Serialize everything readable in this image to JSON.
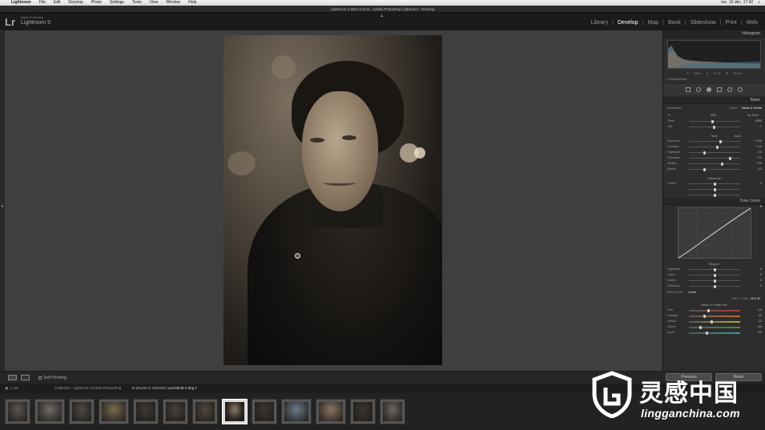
{
  "menubar": {
    "items": [
      "Lightroom",
      "File",
      "Edit",
      "Develop",
      "Photo",
      "Settings",
      "Tools",
      "View",
      "Window",
      "Help"
    ],
    "clock": "lun. 16 déc.  17:42"
  },
  "window": {
    "title": "Lightroom 4 2013-2.lrcat - Adobe Photoshop Lightroom - Develop"
  },
  "branding": {
    "lr": "Lr",
    "small": "Adobe Photoshop",
    "name": "Lightroom 5"
  },
  "modules": [
    {
      "label": "Library",
      "active": false
    },
    {
      "label": "Develop",
      "active": true
    },
    {
      "label": "Map",
      "active": false
    },
    {
      "label": "Book",
      "active": false
    },
    {
      "label": "Slideshow",
      "active": false
    },
    {
      "label": "Print",
      "active": false
    },
    {
      "label": "Web",
      "active": false
    }
  ],
  "right_panel": {
    "histogram_title": "Histogram",
    "hist_info": [
      "R",
      "0,5 %",
      "G",
      "0,7 %",
      "B",
      "10,0 %"
    ],
    "original_photo": "Original Photo",
    "basic_title": "Basic",
    "treatment_label": "Treatment :",
    "treatment_color": "Color",
    "treatment_bw": "Black & White",
    "wb_label": "WB :",
    "wb_value": "As Shot",
    "temp": {
      "label": "Temp",
      "value": "4500"
    },
    "tint": {
      "label": "Tint",
      "value": "- 7"
    },
    "tone_label": "Tone",
    "tone_auto": "Auto",
    "tone_sliders": [
      {
        "label": "Exposure",
        "value": "+ 1,00",
        "pos": 0.62
      },
      {
        "label": "Contrast",
        "value": "+ 13",
        "pos": 0.55
      },
      {
        "label": "Highlights",
        "value": "- 43",
        "pos": 0.3
      },
      {
        "label": "Shadows",
        "value": "+ 73",
        "pos": 0.8
      },
      {
        "label": "Whites",
        "value": "+ 30",
        "pos": 0.65
      },
      {
        "label": "Blacks",
        "value": "- 41",
        "pos": 0.3
      }
    ],
    "presence_label": "Presence",
    "presence_sliders": [
      {
        "label": "Clarity",
        "value": "0",
        "pos": 0.5
      },
      {
        "label": "",
        "value": "",
        "pos": 0.5
      },
      {
        "label": "",
        "value": "",
        "pos": 0.5
      }
    ],
    "tone_curve_title": "Tone Curve",
    "region_label": "Region",
    "region_sliders": [
      {
        "label": "Highlights",
        "value": "0",
        "pos": 0.5
      },
      {
        "label": "Lights",
        "value": "0",
        "pos": 0.5
      },
      {
        "label": "Darks",
        "value": "0",
        "pos": 0.5
      },
      {
        "label": "Shadows",
        "value": "0",
        "pos": 0.5
      }
    ],
    "point_curve_label": "Point Curve :",
    "point_curve_value": "Linear",
    "bw_tabs": [
      "HSL",
      "Color",
      "B & W"
    ],
    "bw_mix_label": "Black & White Mix",
    "bw_sliders": [
      {
        "label": "Red",
        "value": "- 24",
        "pos": 0.38,
        "color": "#b03a3a"
      },
      {
        "label": "Orange",
        "value": "- 41",
        "pos": 0.3,
        "color": "#c07030"
      },
      {
        "label": "Yellow",
        "value": "- 11",
        "pos": 0.45,
        "color": "#b8a838"
      },
      {
        "label": "Green",
        "value": "- 64",
        "pos": 0.22,
        "color": "#3e8a3e"
      },
      {
        "label": "Aqua",
        "value": "- 32",
        "pos": 0.35,
        "color": "#3a9a9a"
      }
    ]
  },
  "toolbar": {
    "soft_proofing": "Soft Proofing",
    "previous": "Previous",
    "reset": "Reset"
  },
  "filmstrip": {
    "collection": "Collection : Lightroom Portrait Retouching",
    "count": "11 photos /1 selected /",
    "file": "portrait-bt-2.dng",
    "thumbs": 15,
    "selected_index": 7
  },
  "watermark": {
    "cn": "灵感中国",
    "url": "lingganchina.com"
  }
}
